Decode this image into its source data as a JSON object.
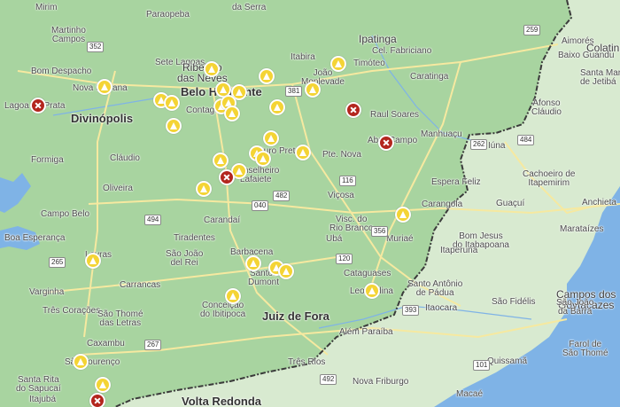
{
  "colors": {
    "region": "#a8d4a0",
    "outside": "#d8ead0",
    "ocean": "#7fb3e6",
    "border": "#3a3a3a",
    "road": "#f6e9a0"
  },
  "places": [
    {
      "id": "paraopeba",
      "label": "Paraopeba"
    },
    {
      "id": "da-serra",
      "label": "da Serra"
    },
    {
      "id": "mirim",
      "label": "Mirim"
    },
    {
      "id": "martinho-campos",
      "label": "Martinho\nCampos"
    },
    {
      "id": "sete-lagoas",
      "label": "Sete Lagoas"
    },
    {
      "id": "ipatinga",
      "label": "Ipatinga"
    },
    {
      "id": "cel-fabriciano",
      "label": "Cel. Fabriciano"
    },
    {
      "id": "itabira",
      "label": "Itabira"
    },
    {
      "id": "timoteo",
      "label": "Timóteo"
    },
    {
      "id": "caratinga",
      "label": "Caratinga"
    },
    {
      "id": "aimores",
      "label": "Aimorés"
    },
    {
      "id": "colatina",
      "label": "Colatina"
    },
    {
      "id": "baixo-guandu",
      "label": "Baixo Guandu"
    },
    {
      "id": "bom-despacho",
      "label": "Bom Despacho"
    },
    {
      "id": "nova-serrana",
      "label": "Nova Serrana"
    },
    {
      "id": "ribeirao-das-neves",
      "label": "Ribeirão\ndas Neves"
    },
    {
      "id": "belo-horizonte",
      "label": "Belo Horizonte"
    },
    {
      "id": "monlevade",
      "label": "João\nMonlevade"
    },
    {
      "id": "santa-maria",
      "label": "Santa Maria\nde Jetibá"
    },
    {
      "id": "lagoa-da-prata",
      "label": "Lagoa da Prata"
    },
    {
      "id": "divinopolis",
      "label": "Divinópolis"
    },
    {
      "id": "contagem",
      "label": "Contagem"
    },
    {
      "id": "raul-soares",
      "label": "Raul Soares"
    },
    {
      "id": "afonso-claudio",
      "label": "Afonso\nCláudio"
    },
    {
      "id": "manhuacu",
      "label": "Manhuaçu"
    },
    {
      "id": "abre-campo",
      "label": "Abre Campo"
    },
    {
      "id": "iuna",
      "label": "Iúna"
    },
    {
      "id": "formiga",
      "label": "Formiga"
    },
    {
      "id": "claudio",
      "label": "Cláudio"
    },
    {
      "id": "ouro-preto",
      "label": "Ouro Preto"
    },
    {
      "id": "pte-nova",
      "label": "Pte. Nova"
    },
    {
      "id": "oliveira",
      "label": "Oliveira"
    },
    {
      "id": "conselheiro-lafaiete",
      "label": "Conselheiro\nLafaiete"
    },
    {
      "id": "espera-feliz",
      "label": "Espera Feliz"
    },
    {
      "id": "cachoeiro",
      "label": "Cachoeiro de\nItapemirim"
    },
    {
      "id": "viscosa",
      "label": "Viçosa"
    },
    {
      "id": "carangola",
      "label": "Carangola"
    },
    {
      "id": "guacui",
      "label": "Guaçuí"
    },
    {
      "id": "anchieta",
      "label": "Anchieta"
    },
    {
      "id": "campo-belo",
      "label": "Campo Belo"
    },
    {
      "id": "carandai",
      "label": "Carandaí"
    },
    {
      "id": "visc-rio-branco",
      "label": "Visc. do\nRio Branco"
    },
    {
      "id": "bom-jesus",
      "label": "Bom Jesus\ndo Itabapoana"
    },
    {
      "id": "marataizes",
      "label": "Marataízes"
    },
    {
      "id": "boa-esperanca",
      "label": "Boa Esperança"
    },
    {
      "id": "tiradentes",
      "label": "Tiradentes"
    },
    {
      "id": "uba",
      "label": "Ubá"
    },
    {
      "id": "muriae",
      "label": "Muriaé"
    },
    {
      "id": "itaperuna",
      "label": "Itaperuna"
    },
    {
      "id": "lavras",
      "label": "Lavras"
    },
    {
      "id": "sao-joao-del-rei",
      "label": "São João\ndel Rei"
    },
    {
      "id": "barbacena",
      "label": "Barbacena"
    },
    {
      "id": "carrancas",
      "label": "Carrancas"
    },
    {
      "id": "santos-dumont",
      "label": "Santos\nDumont"
    },
    {
      "id": "cataguases",
      "label": "Cataguases"
    },
    {
      "id": "santo-antonio-padua",
      "label": "Santo Antônio\nde Pádua"
    },
    {
      "id": "campos",
      "label": "Campos dos\nGoytacazes"
    },
    {
      "id": "varginha",
      "label": "Varginha"
    },
    {
      "id": "leopoldina",
      "label": "Leopoldina"
    },
    {
      "id": "sao-fidelis",
      "label": "São Fidélis"
    },
    {
      "id": "sao-joao-da-barra",
      "label": "São João\nda Barra"
    },
    {
      "id": "tres-coracoes",
      "label": "Três Corações"
    },
    {
      "id": "sao-thome-letras",
      "label": "São Thomé\ndas Letras"
    },
    {
      "id": "conceicao-ibitipoca",
      "label": "Conceição\ndo Ibitipoca"
    },
    {
      "id": "juiz-de-fora",
      "label": "Juiz de Fora"
    },
    {
      "id": "itaocara",
      "label": "Itaocara"
    },
    {
      "id": "alem-paraiba",
      "label": "Além Paraíba"
    },
    {
      "id": "caxambu",
      "label": "Caxambu"
    },
    {
      "id": "farol-de-sao-thome",
      "label": "Farol de\nSão Thomé"
    },
    {
      "id": "sao-lourenco",
      "label": "São Lourenço"
    },
    {
      "id": "quissama",
      "label": "Quissamã"
    },
    {
      "id": "tres-rios",
      "label": "Três Rios"
    },
    {
      "id": "santa-rita-sapucai",
      "label": "Santa Rita\ndo Sapucaí"
    },
    {
      "id": "nova-friburgo",
      "label": "Nova Friburgo"
    },
    {
      "id": "itajuba",
      "label": "Itajubá"
    },
    {
      "id": "macae",
      "label": "Macaé"
    },
    {
      "id": "volta-redonda",
      "label": "Volta Redonda"
    }
  ],
  "shields": [
    "352",
    "259",
    "381",
    "116",
    "484",
    "262",
    "494",
    "482",
    "120",
    "356",
    "265",
    "267",
    "040",
    "393",
    "101",
    "492"
  ],
  "markers": [
    {
      "status": "ok"
    },
    {
      "status": "ok"
    },
    {
      "status": "ok"
    },
    {
      "status": "ok"
    },
    {
      "status": "ok"
    },
    {
      "status": "ok"
    },
    {
      "status": "ok"
    },
    {
      "status": "ok"
    },
    {
      "status": "ok"
    },
    {
      "status": "ok"
    },
    {
      "status": "ok"
    },
    {
      "status": "ok"
    },
    {
      "status": "ok"
    },
    {
      "status": "ok"
    },
    {
      "status": "ok"
    },
    {
      "status": "ok"
    },
    {
      "status": "ok"
    },
    {
      "status": "ok"
    },
    {
      "status": "ok"
    },
    {
      "status": "ok"
    },
    {
      "status": "ok"
    },
    {
      "status": "ok"
    },
    {
      "status": "ok"
    },
    {
      "status": "ok"
    },
    {
      "status": "ok"
    },
    {
      "status": "ok"
    },
    {
      "status": "ok"
    },
    {
      "status": "ok"
    },
    {
      "status": "ok"
    },
    {
      "status": "unavailable"
    },
    {
      "status": "unavailable"
    },
    {
      "status": "unavailable"
    },
    {
      "status": "unavailable"
    },
    {
      "status": "unavailable"
    }
  ]
}
